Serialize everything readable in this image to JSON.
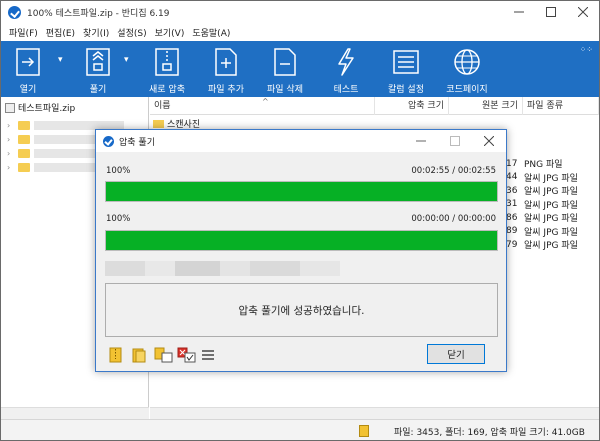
{
  "window": {
    "title": "100% 테스트파일.zip - 반디집 6.19",
    "controls": [
      "minimize",
      "maximize",
      "close"
    ]
  },
  "menu": [
    "파일(F)",
    "편집(E)",
    "찾기(I)",
    "설정(S)",
    "보기(V)",
    "도움말(A)"
  ],
  "toolbar": {
    "open_label": "열기",
    "extract_label": "풀기",
    "new_archive_label": "새로 압축",
    "add_files_label": "파일 추가",
    "delete_files_label": "파일 삭제",
    "test_label": "테스트",
    "columns_label": "칼럼 설정",
    "codepage_label": "코드페이지"
  },
  "tree": {
    "root_label": "테스트파일.zip"
  },
  "filelist": {
    "columns": [
      "이름",
      "압축 크기",
      "원본 크기",
      "파일 종류"
    ],
    "first_row_name": "스캔사진",
    "visible_types": [
      {
        "size_tail": "17",
        "type": "PNG 파일"
      },
      {
        "size_tail": "44",
        "type": "알씨 JPG 파일"
      },
      {
        "size_tail": "36",
        "type": "알씨 JPG 파일"
      },
      {
        "size_tail": "31",
        "type": "알씨 JPG 파일"
      },
      {
        "size_tail": "86",
        "type": "알씨 JPG 파일"
      },
      {
        "size_tail": "89",
        "type": "알씨 JPG 파일"
      },
      {
        "size_tail": "79",
        "type": "알씨 JPG 파일"
      }
    ]
  },
  "status": {
    "text": "파일: 3453, 폴더: 169, 압축 파일 크기: 41.0GB"
  },
  "dialog": {
    "title": "압축 풀기",
    "progress1": {
      "label": "100%",
      "time": "00:02:55 / 00:02:55",
      "value": 1.0
    },
    "progress2": {
      "label": "100%",
      "time": "00:00:00 / 00:00:00",
      "value": 1.0
    },
    "message": "압축 풀기에 성공하였습니다.",
    "close_button": "닫기"
  },
  "colors": {
    "toolbar_bg": "#1f6fc3",
    "progress_fill": "#06b025",
    "accent": "#0078d7"
  }
}
